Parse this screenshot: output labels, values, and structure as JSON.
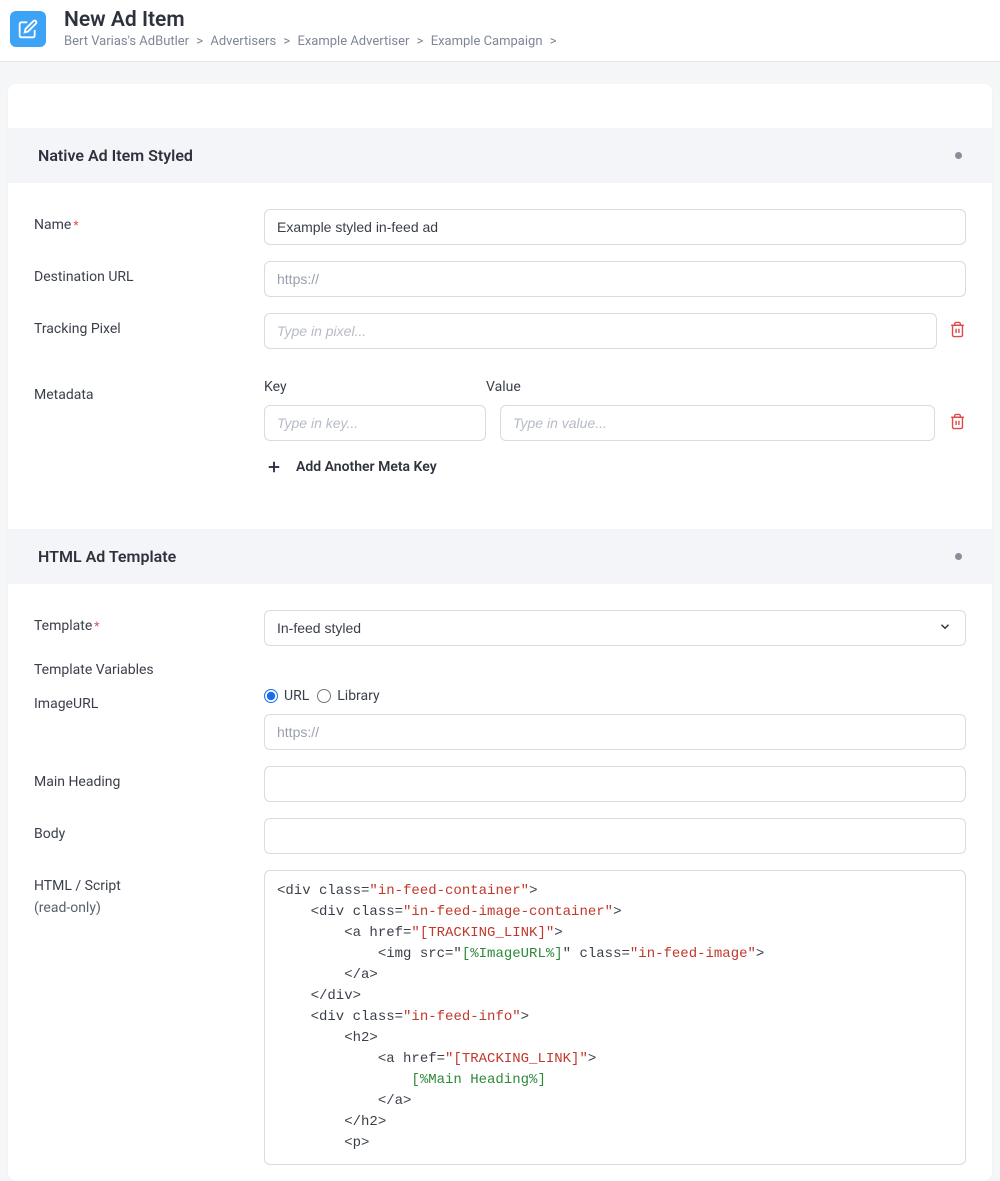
{
  "header": {
    "title": "New Ad Item",
    "breadcrumb": [
      "Bert Varias's AdButler",
      "Advertisers",
      "Example Advertiser",
      "Example Campaign"
    ]
  },
  "section1": {
    "title": "Native Ad Item Styled",
    "fields": {
      "name_label": "Name",
      "name_value": "Example styled in-feed ad",
      "dest_label": "Destination URL",
      "dest_placeholder": "https://",
      "tracking_label": "Tracking Pixel",
      "tracking_placeholder": "Type in pixel...",
      "metadata_label": "Metadata",
      "key_label": "Key",
      "value_label": "Value",
      "key_placeholder": "Type in key...",
      "value_placeholder": "Type in value...",
      "add_meta_label": "Add Another Meta Key"
    }
  },
  "section2": {
    "title": "HTML Ad Template",
    "fields": {
      "template_label": "Template",
      "template_value": "In-feed styled",
      "template_vars_label": "Template Variables",
      "imageurl_label": "ImageURL",
      "radio_url": "URL",
      "radio_library": "Library",
      "imageurl_placeholder": "https://",
      "main_heading_label": "Main Heading",
      "body_label": "Body",
      "html_label": "HTML / Script",
      "readonly_label": "(read-only)"
    }
  },
  "code_lines": [
    {
      "indent": 0,
      "pre": "<div class=",
      "str": "\"in-feed-container\"",
      "post": ">"
    },
    {
      "indent": 1,
      "pre": "<div class=",
      "str": "\"in-feed-image-container\"",
      "post": ">"
    },
    {
      "indent": 2,
      "pre": "<a href=",
      "str": "\"[TRACKING_LINK]\"",
      "post": ">"
    },
    {
      "indent": 3,
      "pre": "<img src=\"",
      "var": "[%ImageURL%]",
      "mid": "\" class=",
      "str": "\"in-feed-image\"",
      "post": ">"
    },
    {
      "indent": 2,
      "pre": "</a>"
    },
    {
      "indent": 1,
      "pre": "</div>"
    },
    {
      "indent": 1,
      "pre": "<div class=",
      "str": "\"in-feed-info\"",
      "post": ">"
    },
    {
      "indent": 2,
      "pre": "<h2>"
    },
    {
      "indent": 3,
      "pre": "<a href=",
      "str": "\"[TRACKING_LINK]\"",
      "post": ">"
    },
    {
      "indent": 4,
      "var": "[%Main Heading%]"
    },
    {
      "indent": 3,
      "pre": "</a>"
    },
    {
      "indent": 2,
      "pre": "</h2>"
    },
    {
      "indent": 2,
      "pre": "<p>"
    }
  ]
}
